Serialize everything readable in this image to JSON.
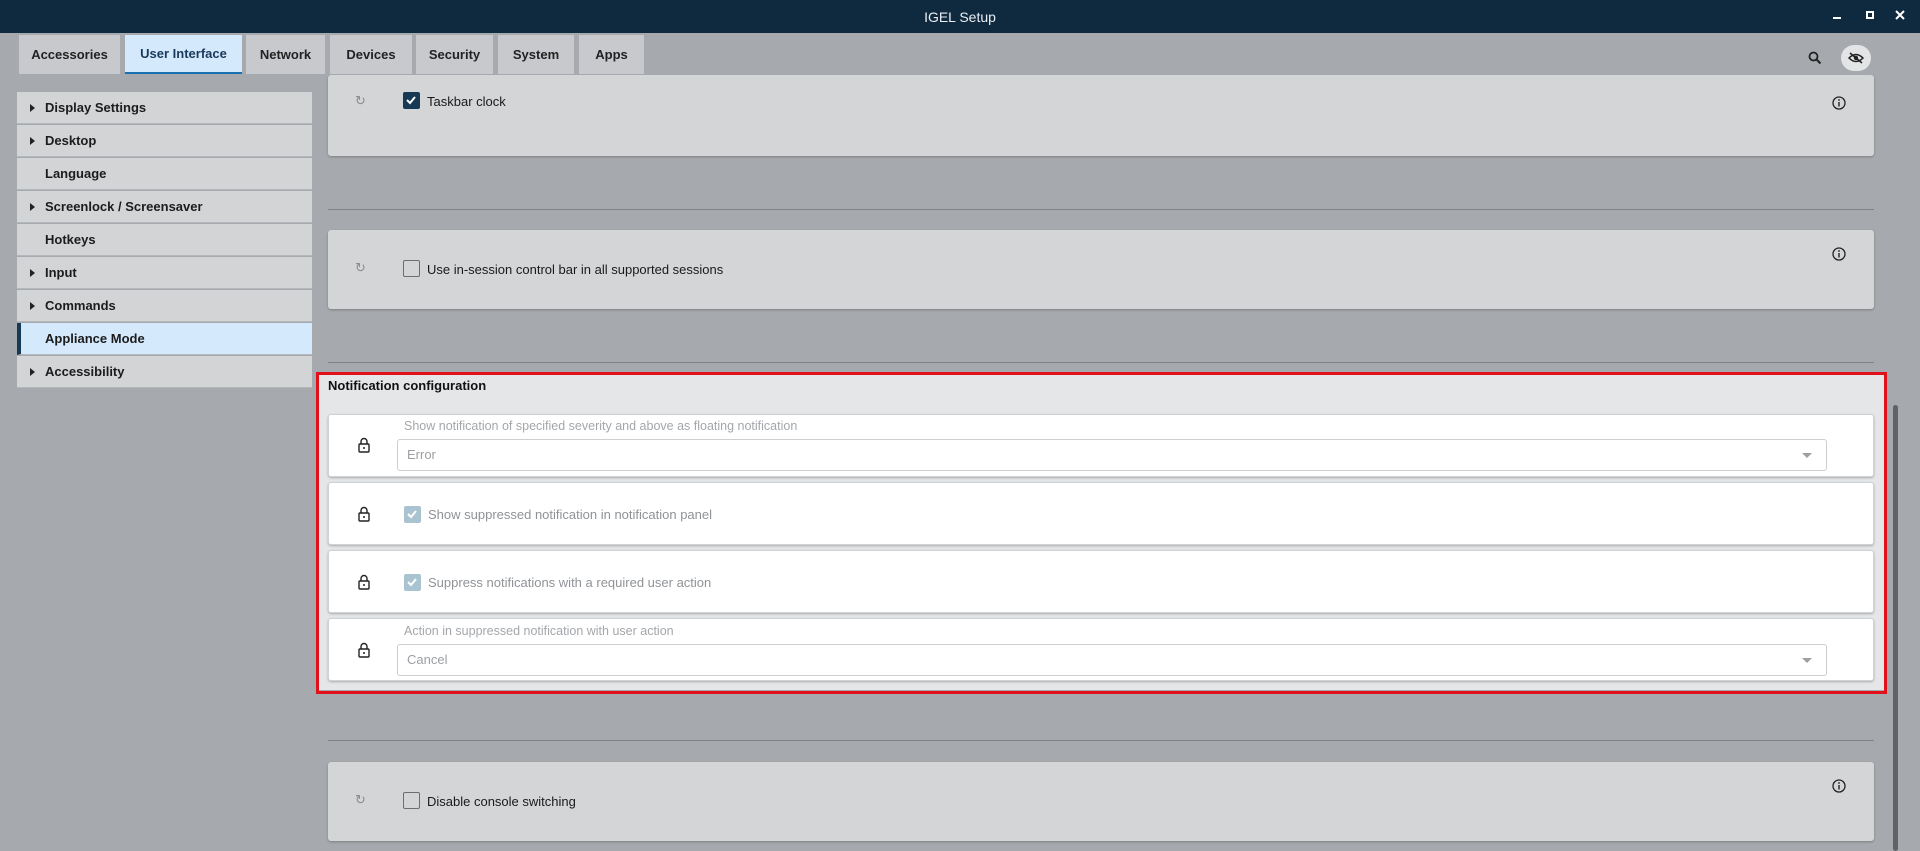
{
  "window": {
    "title": "IGEL Setup",
    "minimize_glyph": "▁",
    "maximize_glyph": "▫",
    "close_glyph": "✕"
  },
  "tabs": [
    {
      "label": "Accessories",
      "active": false
    },
    {
      "label": "User Interface",
      "active": true
    },
    {
      "label": "Network",
      "active": false
    },
    {
      "label": "Devices",
      "active": false
    },
    {
      "label": "Security",
      "active": false
    },
    {
      "label": "System",
      "active": false
    },
    {
      "label": "Apps",
      "active": false
    }
  ],
  "toolbar_icons": [
    "search-icon",
    "view-toggle-icon"
  ],
  "sidebar": {
    "items": [
      {
        "label": "Display Settings",
        "expandable": true
      },
      {
        "label": "Desktop",
        "expandable": true
      },
      {
        "label": "Language",
        "expandable": false
      },
      {
        "label": "Screenlock / Screensaver",
        "expandable": true
      },
      {
        "label": "Hotkeys",
        "expandable": false
      },
      {
        "label": "Input",
        "expandable": true
      },
      {
        "label": "Commands",
        "expandable": true
      },
      {
        "label": "Appliance Mode",
        "expandable": false,
        "active": true
      },
      {
        "label": "Accessibility",
        "expandable": true
      }
    ]
  },
  "settings": {
    "taskbar_clock": {
      "label": "Taskbar clock",
      "checked": true
    },
    "in_session_bar": {
      "label": "Use in-session control bar in all supported sessions",
      "checked": false
    },
    "notification": {
      "title": "Notification configuration",
      "severity": {
        "caption": "Show notification of specified severity and above as floating notification",
        "value": "Error"
      },
      "show_suppressed": {
        "label": "Show suppressed notification in notification panel",
        "checked": true
      },
      "suppress_required": {
        "label": "Suppress notifications with a required user action",
        "checked": true
      },
      "action": {
        "caption": "Action in suppressed notification with user action",
        "value": "Cancel"
      }
    },
    "disable_console": {
      "label": "Disable console switching",
      "checked": false
    }
  },
  "colors": {
    "titlebar": "#0f2a3f",
    "active_tab": "#d4e9fb",
    "highlight": "#e0111b",
    "checkbox_checked": "#163a56"
  }
}
